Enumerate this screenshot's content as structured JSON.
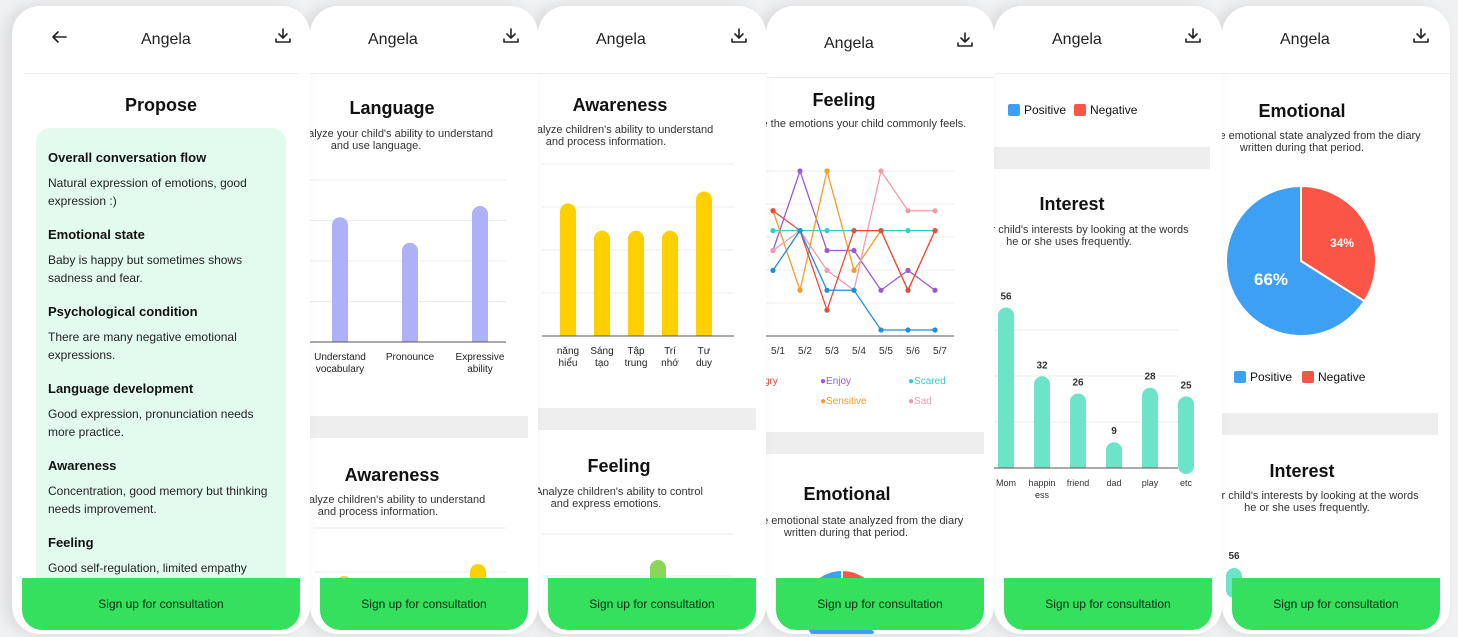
{
  "user_name": "Angela",
  "cta_label": "Sign up for consultation",
  "propose": {
    "title": "Propose",
    "items": [
      {
        "title": "Overall conversation flow",
        "desc": "Natural expression of emotions, good expression :)"
      },
      {
        "title": "Emotional state",
        "desc": "Baby is happy but sometimes shows sadness and fear."
      },
      {
        "title": "Psychological condition",
        "desc": "There are many negative emotional expressions."
      },
      {
        "title": "Language development",
        "desc": "Good expression, pronunciation needs more practice."
      },
      {
        "title": "Awareness",
        "desc": "Concentration, good memory but thinking needs improvement."
      },
      {
        "title": "Feeling",
        "desc": "Good self-regulation, limited empathy"
      }
    ]
  },
  "language": {
    "title": "Language",
    "subtitle_l1": "nalyze your child's ability to understand",
    "subtitle_l2": "and use language.",
    "chart_data": {
      "type": "bar",
      "categories": [
        "Understand vocabulary",
        "Pronounce",
        "Expressive ability"
      ],
      "values": [
        0.78,
        0.62,
        0.85
      ],
      "color": "#b0b0f8"
    },
    "cat_labels": [
      [
        "Understand",
        "vocabulary"
      ],
      [
        "Pronounce",
        ""
      ],
      [
        "Expressive",
        "ability"
      ]
    ]
  },
  "awareness": {
    "title": "Awareness",
    "subtitle_l1": "nalyze children's ability to understand",
    "subtitle_l2": "and process information.",
    "chart_data": {
      "type": "bar",
      "categories": [
        "năng hiểu",
        "Sáng tạo",
        "Tập trung",
        "Trí nhớ",
        "Tư duy"
      ],
      "values": [
        0.78,
        0.62,
        0.62,
        0.62,
        0.85
      ],
      "color": "#ffd000"
    },
    "cat_labels": [
      [
        "năng",
        "hiểu"
      ],
      [
        "Sáng",
        "tạo"
      ],
      [
        "Tập",
        "trung"
      ],
      [
        "Trí",
        "nhớ"
      ],
      [
        "Tư",
        "duy"
      ]
    ]
  },
  "feeling": {
    "title": "Feeling",
    "subtitle_full": "Analyze children's ability to control",
    "subtitle_l2": "and express emotions.",
    "subtitle_short": "ze the emotions your child commonly feels.",
    "chart_data": {
      "type": "line",
      "x": [
        "5/1",
        "5/2",
        "5/3",
        "5/4",
        "5/5",
        "5/6",
        "5/7"
      ],
      "series": [
        {
          "name": "Enjoy",
          "color": "#9b59d6",
          "values": [
            2,
            4,
            2,
            2,
            1,
            1.5,
            1
          ]
        },
        {
          "name": "Scared",
          "color": "#3cc8c8",
          "values": [
            2.5,
            2.5,
            2.5,
            2.5,
            2.5,
            2.5,
            2.5
          ]
        },
        {
          "name": "Sensitive",
          "color": "#f39c2a",
          "values": [
            3,
            1,
            4,
            1.5,
            2.5,
            1,
            2.5
          ]
        },
        {
          "name": "Sad",
          "color": "#f29aaa",
          "values": [
            2,
            2.5,
            1.5,
            1,
            4,
            3,
            3
          ]
        },
        {
          "name": "Angry",
          "color": "#e74c3c",
          "values": [
            3,
            2.5,
            0.5,
            2.5,
            2.5,
            1,
            2.5
          ]
        },
        {
          "name": "",
          "color": "#1e8fd8",
          "values": [
            1.5,
            2.5,
            1,
            1,
            0,
            0,
            0
          ]
        }
      ]
    },
    "legend_enjoy": "Enjoy",
    "legend_scared": "Scared",
    "legend_sensitive": "Sensitive",
    "legend_sad": "Sad",
    "legend_angry_tail": "gry",
    "first_tick_tail": "5/1"
  },
  "emotional": {
    "title": "Emotional",
    "subtitle_l1": "he emotional state analyzed from the diary",
    "subtitle_l2": "written during that period.",
    "chart_data": {
      "type": "pie",
      "slices": [
        {
          "name": "Positive",
          "value": 66,
          "color": "#3ea0f5"
        },
        {
          "name": "Negative",
          "value": 34,
          "color": "#fb5548"
        }
      ]
    },
    "label_positive": "66%",
    "label_negative": "34%",
    "legend_positive": "Positive",
    "legend_negative": "Negative"
  },
  "interest": {
    "title": "Interest",
    "subtitle_l1": "ur child's interests by looking at the words",
    "subtitle_l2": "he or she uses frequently.",
    "chart_data": {
      "type": "bar",
      "categories": [
        "Mom",
        "happiness",
        "friend",
        "dad",
        "play",
        "etc"
      ],
      "values": [
        56,
        32,
        26,
        9,
        28,
        25
      ],
      "color": "#6de4c7"
    },
    "value_labels": [
      "56",
      "32",
      "26",
      "9",
      "28",
      "25"
    ],
    "cat_labels": [
      [
        "Mom",
        ""
      ],
      [
        "happin",
        "ess"
      ],
      [
        "friend",
        ""
      ],
      [
        "dad",
        ""
      ],
      [
        "play",
        ""
      ],
      [
        "etc",
        ""
      ]
    ],
    "partial_value": "56"
  }
}
